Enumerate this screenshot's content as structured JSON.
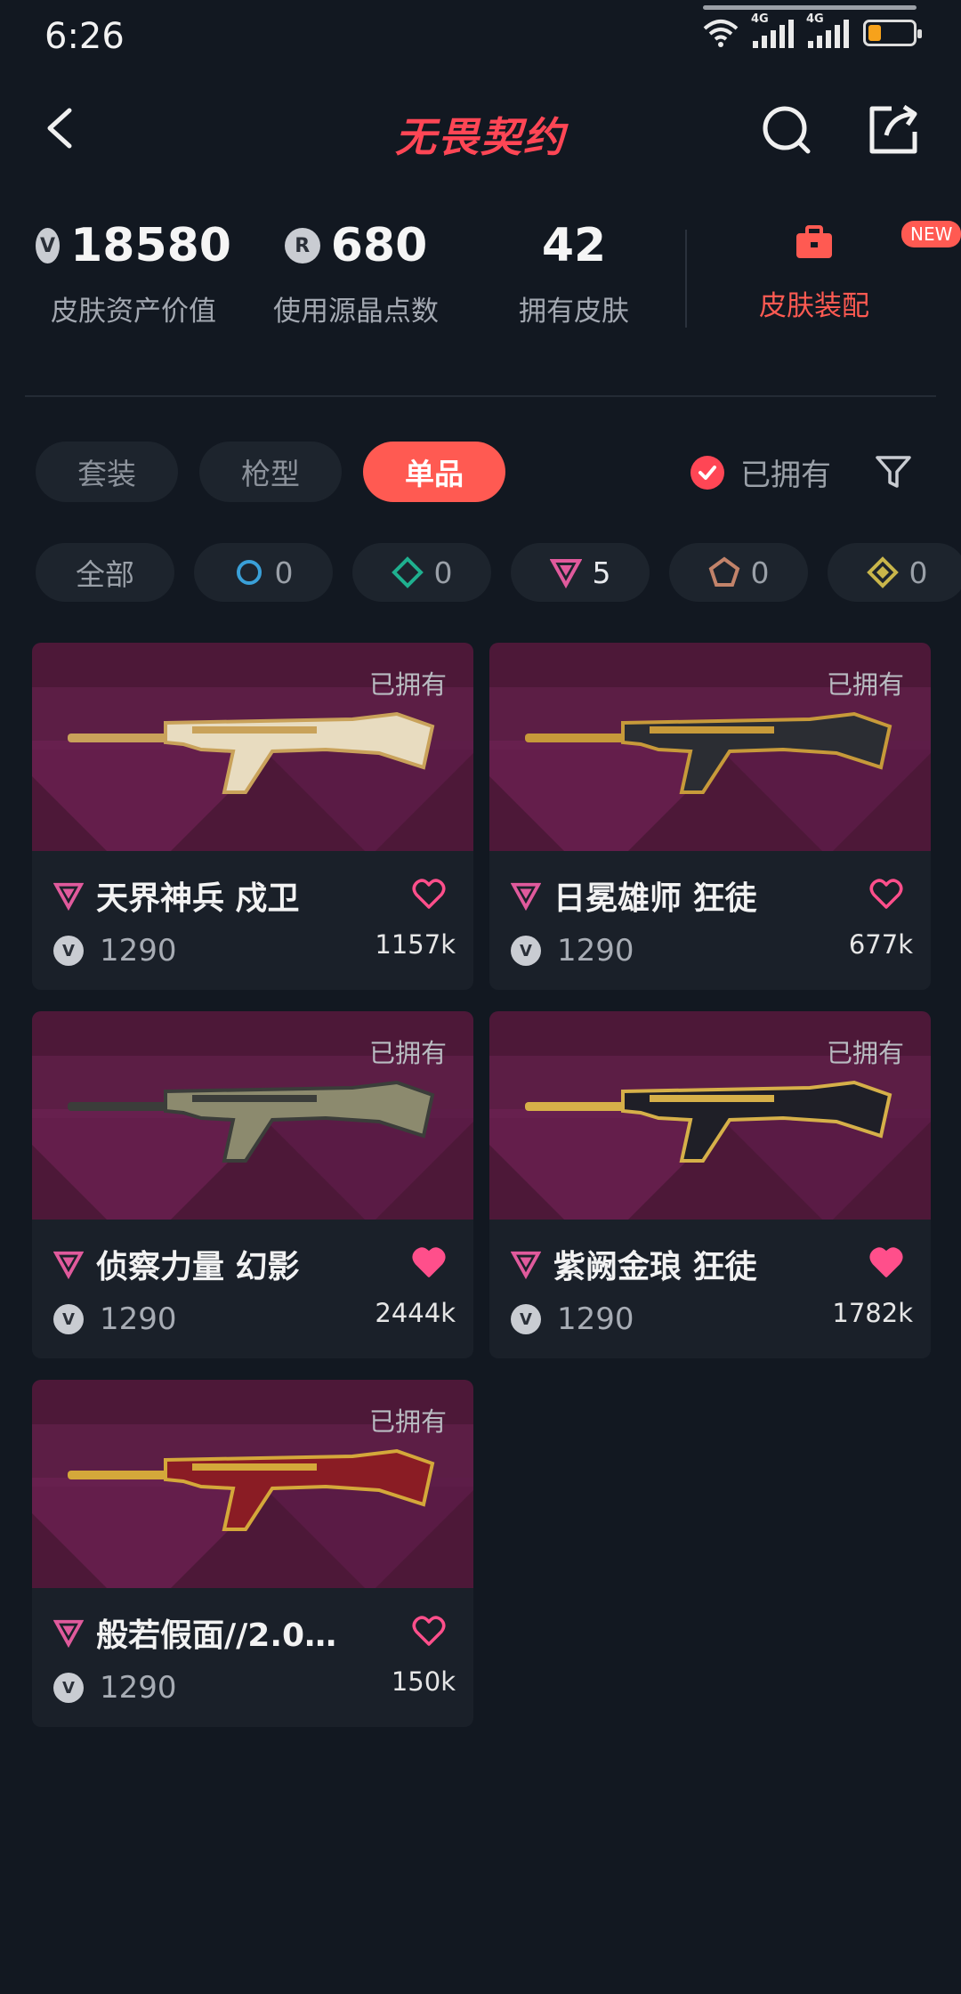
{
  "status": {
    "time": "6:26",
    "signal_a": "4G",
    "signal_b": "4G"
  },
  "header": {
    "title": "无畏契约"
  },
  "stats": [
    {
      "value": "18580",
      "label": "皮肤资产价值",
      "icon": "vp-coin-icon"
    },
    {
      "value": "680",
      "label": "使用源晶点数",
      "icon": "radianite-icon"
    },
    {
      "value": "42",
      "label": "拥有皮肤"
    }
  ],
  "loadout": {
    "label": "皮肤装配",
    "badge": "NEW"
  },
  "tabs": [
    {
      "label": "套装",
      "active": false
    },
    {
      "label": "枪型",
      "active": false
    },
    {
      "label": "单品",
      "active": true
    }
  ],
  "owned_filter": {
    "label": "已拥有",
    "checked": true
  },
  "rarity_filters": [
    {
      "label": "全部",
      "count": ""
    },
    {
      "label": "",
      "count": "0",
      "icon": "select-tier-icon",
      "color": "#3aa0d8"
    },
    {
      "label": "",
      "count": "0",
      "icon": "deluxe-tier-icon",
      "color": "#1fb08f"
    },
    {
      "label": "",
      "count": "5",
      "icon": "premium-tier-icon",
      "color": "#e05a9c"
    },
    {
      "label": "",
      "count": "0",
      "icon": "ultra-tier-icon",
      "color": "#c2836a"
    },
    {
      "label": "",
      "count": "0",
      "icon": "exclusive-tier-icon",
      "color": "#c9b64a"
    }
  ],
  "cards": [
    {
      "owned": "已拥有",
      "name": "天界神兵 戍卫",
      "price": "1290",
      "likes": "1157k",
      "liked": false,
      "gun_color": "#e8dcc0",
      "gun_accent": "#c9a25a"
    },
    {
      "owned": "已拥有",
      "name": "日冕雄师 狂徒",
      "price": "1290",
      "likes": "677k",
      "liked": false,
      "gun_color": "#2b2d33",
      "gun_accent": "#c79a3a"
    },
    {
      "owned": "已拥有",
      "name": "侦察力量 幻影",
      "price": "1290",
      "likes": "2444k",
      "liked": true,
      "gun_color": "#8c8a6e",
      "gun_accent": "#3b3d3a"
    },
    {
      "owned": "已拥有",
      "name": "紫阙金琅 狂徒",
      "price": "1290",
      "likes": "1782k",
      "liked": true,
      "gun_color": "#1f1f27",
      "gun_accent": "#d6b049"
    },
    {
      "owned": "已拥有",
      "name": "般若假面//2.0…",
      "price": "1290",
      "likes": "150k",
      "liked": false,
      "gun_color": "#8a1c24",
      "gun_accent": "#d4a83a"
    }
  ],
  "colors": {
    "accent": "#ff5a52",
    "premium": "#e05a9c",
    "bg": "#121821"
  }
}
